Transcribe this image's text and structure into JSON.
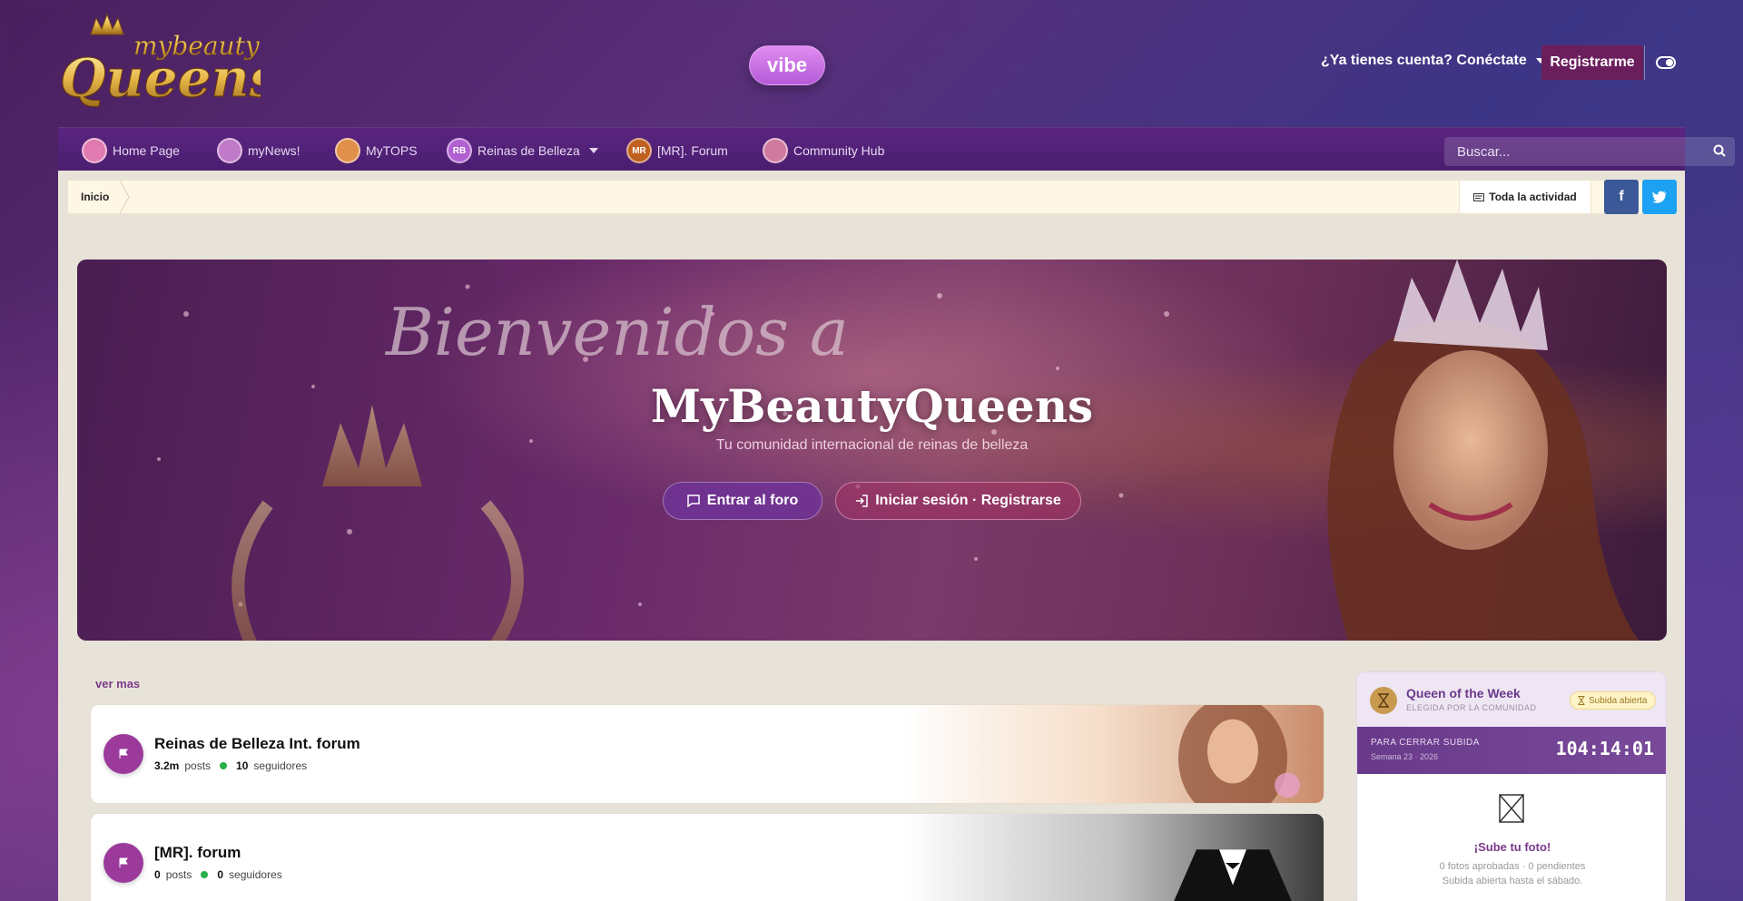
{
  "header": {
    "logo_text": "mybeauty Queens",
    "vibe_label": "vibe",
    "login_label": "¿Ya tienes cuenta? Conéctate",
    "register_label": "Registrarme"
  },
  "nav": {
    "items": [
      {
        "label": "Home Page",
        "icon": "home-page-icon",
        "color": "#e07ab0"
      },
      {
        "label": "myNews!",
        "icon": "news-icon",
        "color": "#c07ac8"
      },
      {
        "label": "MyTOPS",
        "icon": "tops-icon",
        "color": "#e0904a"
      },
      {
        "label": "Reinas de Belleza",
        "icon": "rb-icon",
        "badge": "RB",
        "color": "#b060d0"
      },
      {
        "label": "[MR]. Forum",
        "icon": "mr-icon",
        "badge": "MR",
        "color": "#c06020"
      },
      {
        "label": "Community Hub",
        "icon": "community-icon",
        "color": "#d07aa0"
      }
    ],
    "search_placeholder": "Buscar..."
  },
  "breadcrumb": {
    "home": "Inicio",
    "all_activity": "Toda la actividad"
  },
  "hero": {
    "script_text": "Bienvenidos a",
    "title": "MyBeautyQueens",
    "subtitle": "Tu comunidad internacional de reinas de belleza",
    "enter_button": "Entrar al foro",
    "login_button": "Iniciar sesión · Registrarse"
  },
  "ver_mas": "ver mas",
  "forums": [
    {
      "title": "Reinas de Belleza Int. forum",
      "posts": "3.2m",
      "posts_label": "posts",
      "followers": "10",
      "followers_label": "seguidores"
    },
    {
      "title": "[MR]. forum",
      "posts": "0",
      "posts_label": "posts",
      "followers": "0",
      "followers_label": "seguidores"
    }
  ],
  "qotw": {
    "title": "Queen of the Week",
    "subtitle": "ELEGIDA POR LA COMUNIDAD",
    "pill": "Subida abierta",
    "countdown_label": "PARA CERRAR SUBIDA",
    "week": "Semana 23 · 2026",
    "countdown": "104:14:01",
    "upload_title": "¡Sube tu foto!",
    "upload_stat": "0 fotos aprobadas · 0 pendientes",
    "upload_note": "Subida abierta hasta el sábado."
  },
  "colors": {
    "accent": "#9b3a9b",
    "register_bg": "#6b1e5c",
    "facebook": "#3b5998",
    "twitter": "#1da1f2"
  }
}
